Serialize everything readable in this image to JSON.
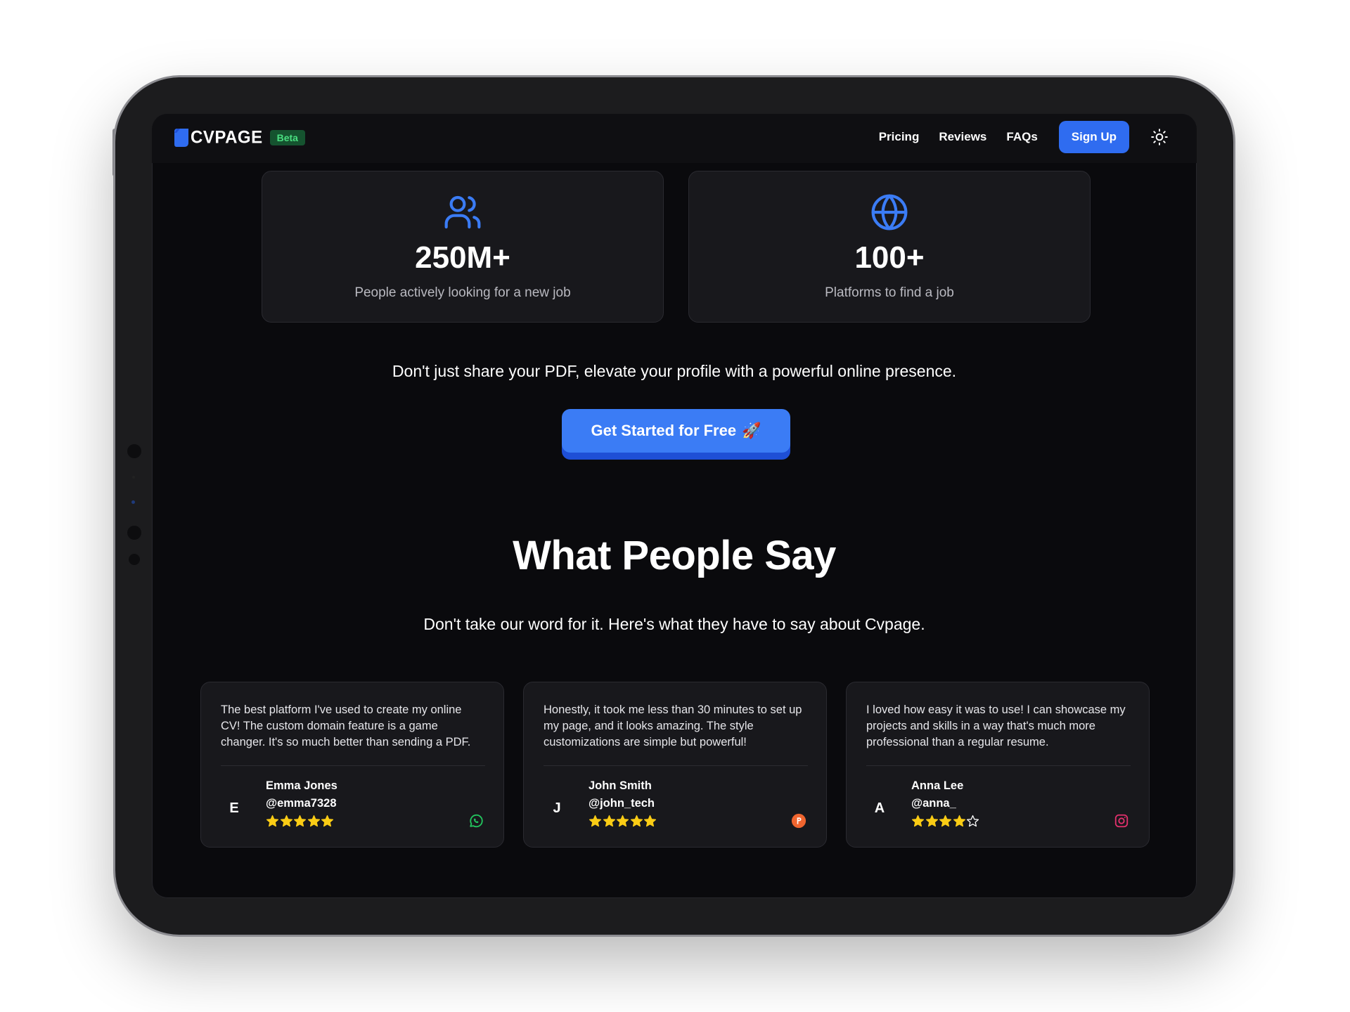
{
  "brand": {
    "name": "CVPAGE",
    "badge": "Beta"
  },
  "nav": {
    "links": [
      "Pricing",
      "Reviews",
      "FAQs"
    ],
    "signup_label": "Sign Up",
    "theme_toggle_icon": "sun-icon"
  },
  "stats": [
    {
      "icon": "users-icon",
      "value": "250M+",
      "label": "People actively looking for a new job"
    },
    {
      "icon": "globe-icon",
      "value": "100+",
      "label": "Platforms to find a job"
    }
  ],
  "tagline": "Don't just share your PDF, elevate your profile with a powerful online presence.",
  "cta": {
    "label": "Get Started for Free",
    "emoji": "🚀"
  },
  "testimonials": {
    "title": "What People Say",
    "subtitle": "Don't take our word for it. Here's what they have to say about Cvpage.",
    "reviews": [
      {
        "text": "The best platform I've used to create my online CV! The custom domain feature is a game changer. It's so much better than sending a PDF.",
        "initial": "E",
        "name": "Emma Jones",
        "handle": "@emma7328",
        "rating": 5,
        "platform_icon": "whatsapp-icon"
      },
      {
        "text": "Honestly, it took me less than 30 minutes to set up my page, and it looks amazing. The style customizations are simple but powerful!",
        "initial": "J",
        "name": "John Smith",
        "handle": "@john_tech",
        "rating": 5,
        "platform_icon": "producthunt-icon"
      },
      {
        "text": "I loved how easy it was to use! I can showcase my projects and skills in a way that's much more professional than a regular resume.",
        "initial": "A",
        "name": "Anna Lee",
        "handle": "@anna_",
        "rating": 4,
        "platform_icon": "instagram-icon"
      }
    ]
  },
  "colors": {
    "accent": "#2f6cf0",
    "star": "#facc15",
    "beta_bg": "#15532f",
    "beta_text": "#4ade80"
  }
}
